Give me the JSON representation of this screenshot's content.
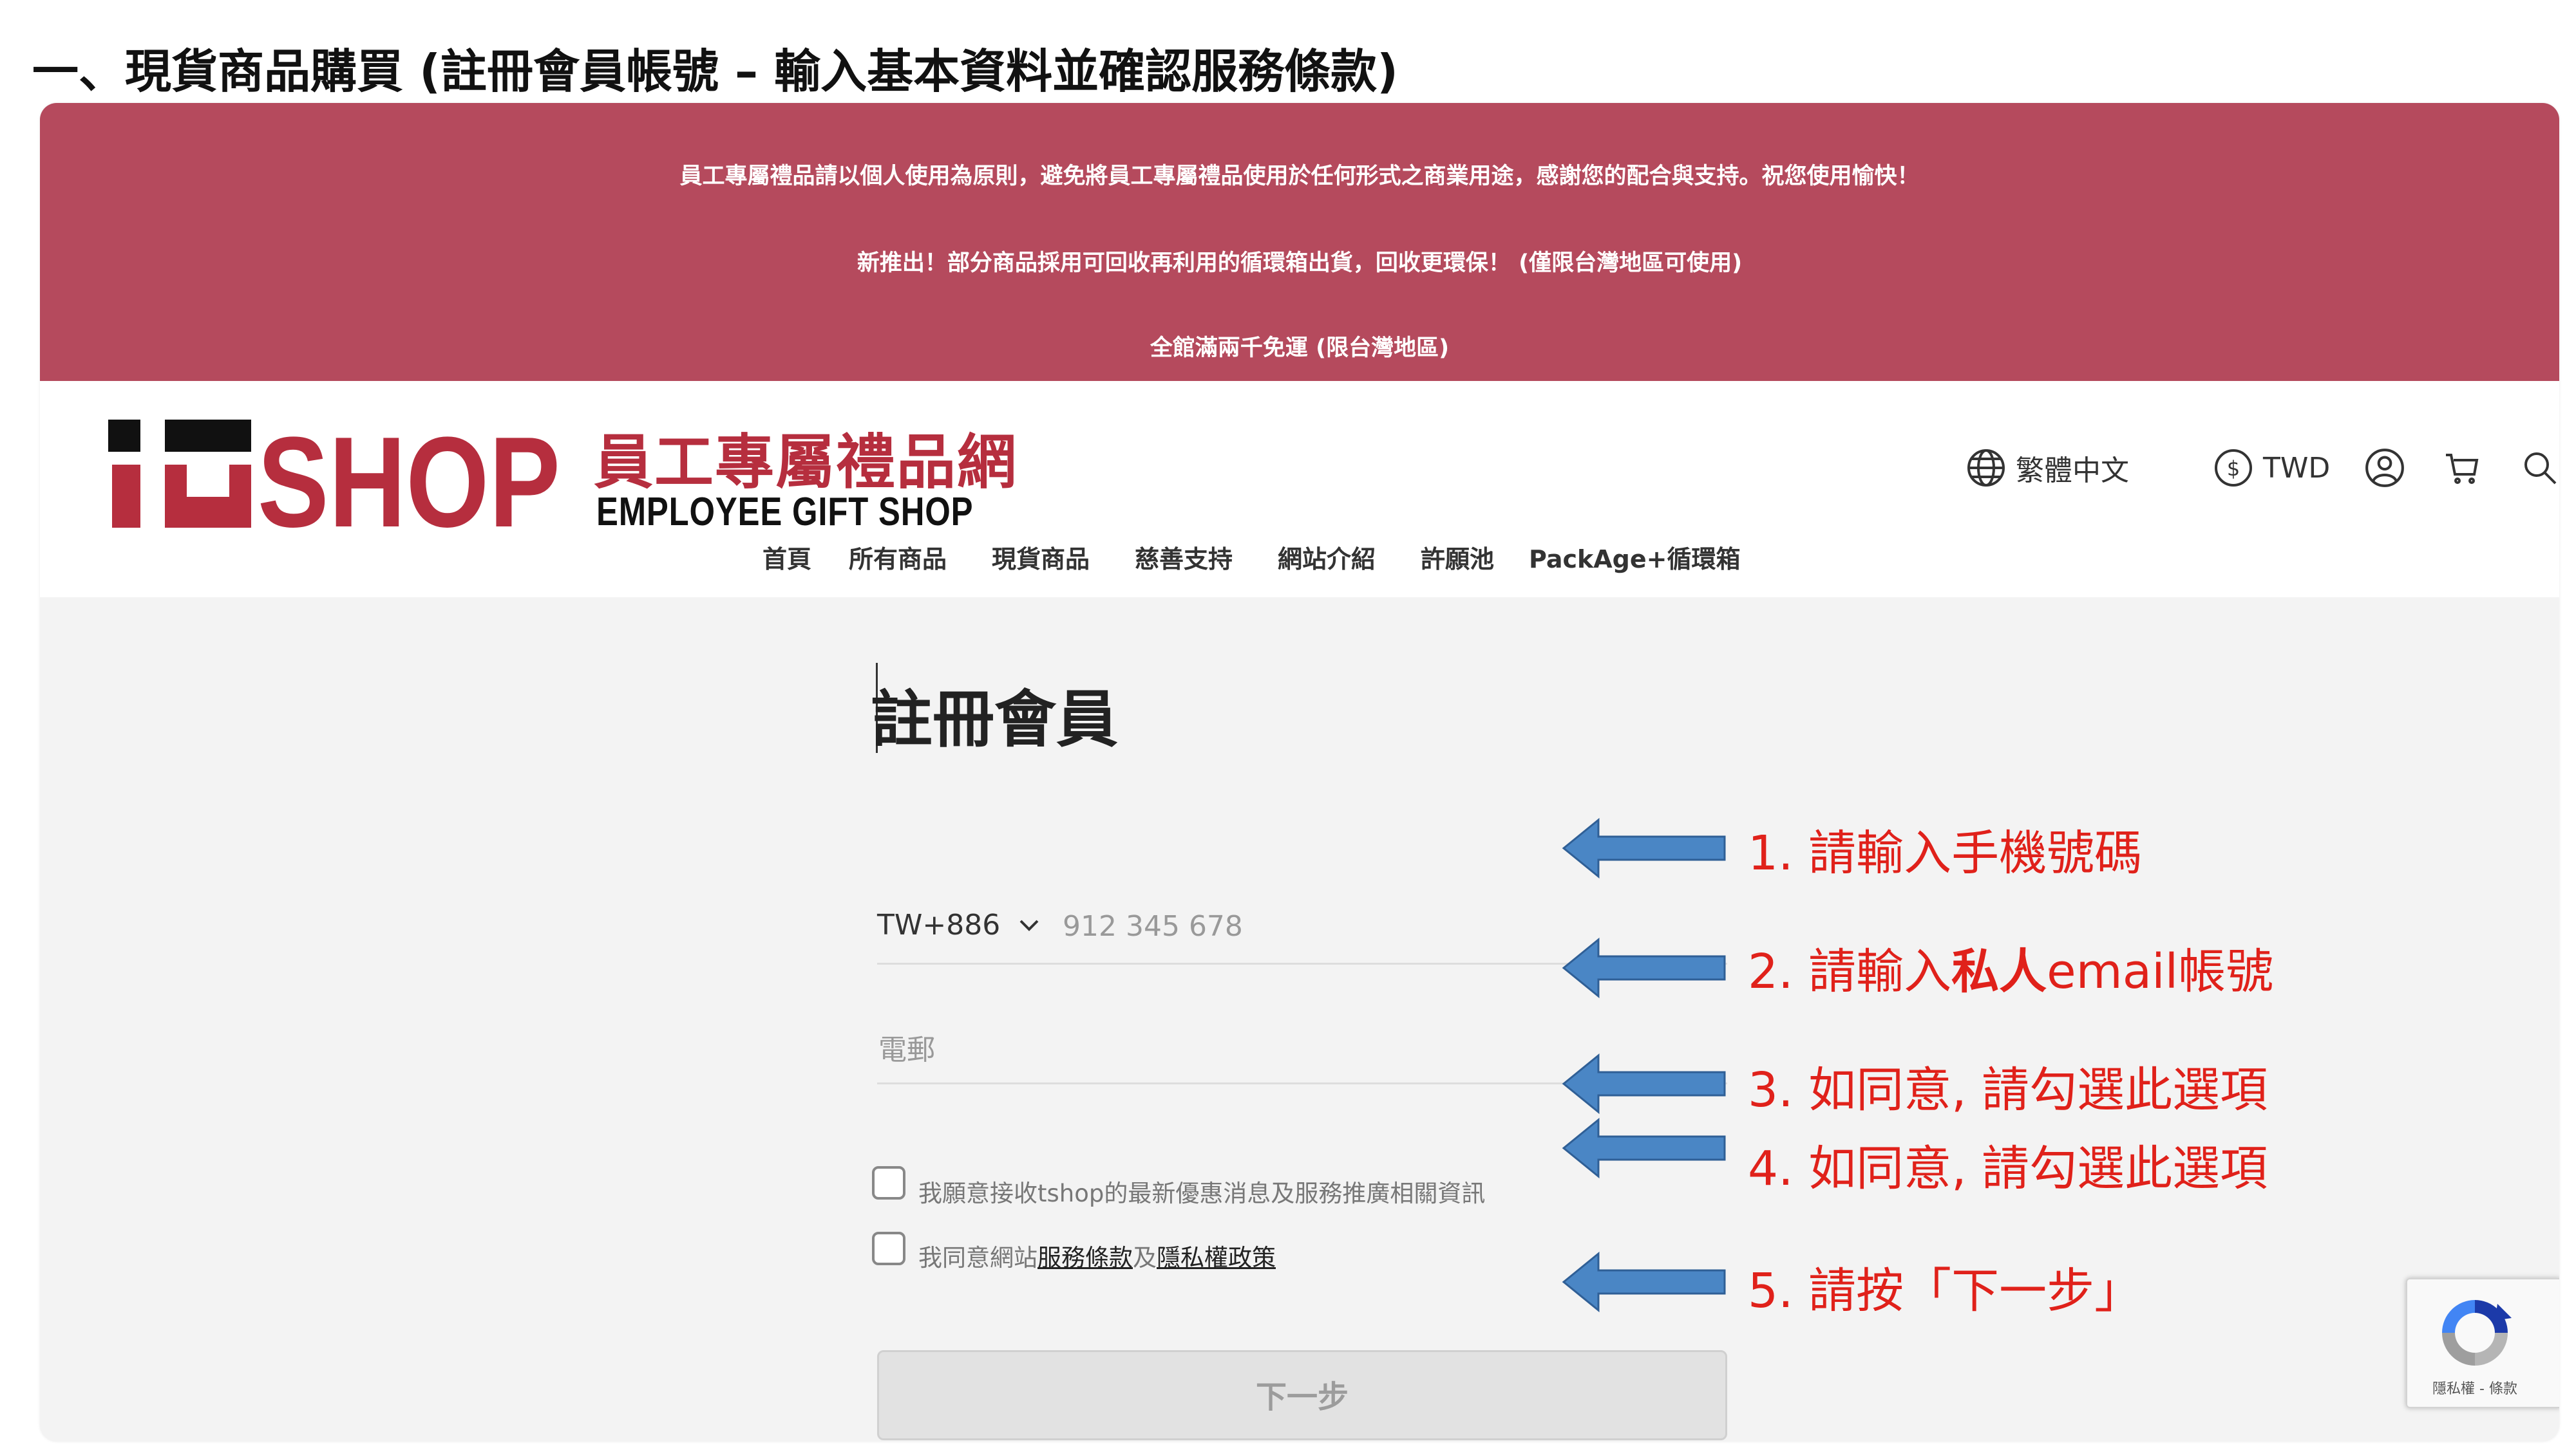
{
  "document": {
    "heading": "一、現貨商品購買 (註冊會員帳號 – 輸入基本資料並確認服務條款)"
  },
  "announcement": {
    "lines": [
      "員工專屬禮品請以個人使用為原則，避免將員工專屬禮品使用於任何形式之商業用途，感謝您的配合與支持。祝您使用愉快！",
      "新推出！部分商品採用可回收再利用的循環箱出貨，回收更環保！ (僅限台灣地區可使用)",
      "全館滿兩千免運 (限台灣地區)"
    ],
    "background": "#b54a5d"
  },
  "header": {
    "logo": {
      "mark_text": "tSHOP",
      "title_cn": "員工專屬禮品網",
      "title_en": "EMPLOYEE GIFT SHOP",
      "brand_color": "#b62e3e"
    },
    "utilities": {
      "language": "繁體中文",
      "currency": "TWD",
      "icons": [
        "globe-icon",
        "dollar-icon",
        "user-icon",
        "cart-icon",
        "search-icon"
      ]
    },
    "nav": [
      "首頁",
      "所有商品",
      "現貨商品",
      "慈善支持",
      "網站介紹",
      "許願池",
      "PackAge+循環箱"
    ]
  },
  "form": {
    "title": "註冊會員",
    "phone": {
      "country_code": "TW+886",
      "placeholder": "912 345 678"
    },
    "email": {
      "placeholder": "電郵"
    },
    "checkboxes": [
      {
        "label": "我願意接收tshop的最新優惠消息及服務推廣相關資訊",
        "checked": false
      },
      {
        "label_prefix": "我同意網站",
        "link1": "服務條款",
        "joiner": "及",
        "link2": "隱私權政策",
        "checked": false
      }
    ],
    "next_button": "下一步"
  },
  "annotations": {
    "color": "#e0211a",
    "arrow_color": "#4a86c5",
    "notes": [
      {
        "text": "1. 請輸入手機號碼"
      },
      {
        "prefix": "2. 請輸入",
        "bold": "私人",
        "suffix": "email帳號"
      },
      {
        "text": "3. 如同意, 請勾選此選項"
      },
      {
        "text": "4. 如同意, 請勾選此選項"
      },
      {
        "text": "5. 請按「下一步」"
      }
    ]
  },
  "recaptcha": {
    "links": "隱私權 - 條款"
  }
}
